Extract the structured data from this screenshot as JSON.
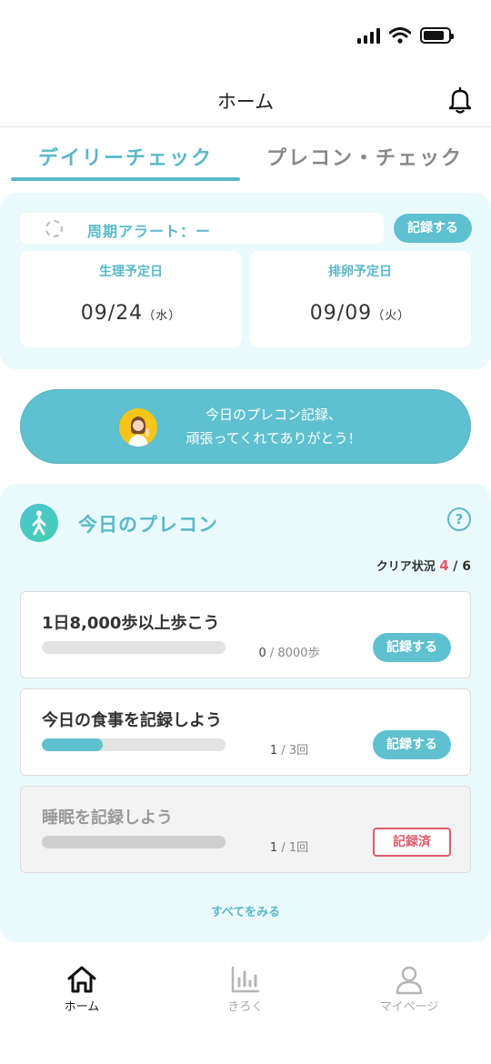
{
  "header": {
    "title": "ホーム"
  },
  "tabs": [
    {
      "label": "デイリーチェック",
      "active": true
    },
    {
      "label": "プレコン・チェック",
      "active": false
    }
  ],
  "cycle": {
    "alert_label": "周期アラート：ー",
    "record_button": "記録する",
    "period": {
      "label": "生理予定日",
      "date": "09/24",
      "weekday": "（水）"
    },
    "ovulation": {
      "label": "排卵予定日",
      "date": "09/09",
      "weekday": "（火）"
    }
  },
  "banner": {
    "line1": "今日のプレコン記録、",
    "line2": "頑張ってくれてありがとう！"
  },
  "today": {
    "title": "今日のプレコン",
    "help": "?",
    "clear_label": "クリア状況",
    "clear_count": "4",
    "clear_total": "/ 6",
    "tasks": [
      {
        "title": "1日8,000歩以上歩こう",
        "current": "0",
        "target": "/ 8000歩",
        "progress": 0.0,
        "button": "記録する",
        "done": false
      },
      {
        "title": "今日の食事を記録しよう",
        "current": "1",
        "target": "/ 3回",
        "progress": 0.33,
        "button": "記録する",
        "done": false
      },
      {
        "title": "睡眠を記録しよう",
        "current": "1",
        "target": "/ 1回",
        "progress": 1.0,
        "button": "記録済",
        "done": true
      }
    ],
    "see_all": "すべてをみる"
  },
  "nav": [
    {
      "label": "ホーム",
      "active": true
    },
    {
      "label": "きろく",
      "active": false
    },
    {
      "label": "マイページ",
      "active": false
    }
  ],
  "colors": {
    "accent": "#5fc0cf",
    "accent_text": "#5ab8c9",
    "alert_red": "#e05a6b",
    "section_bg": "#eafafc"
  }
}
